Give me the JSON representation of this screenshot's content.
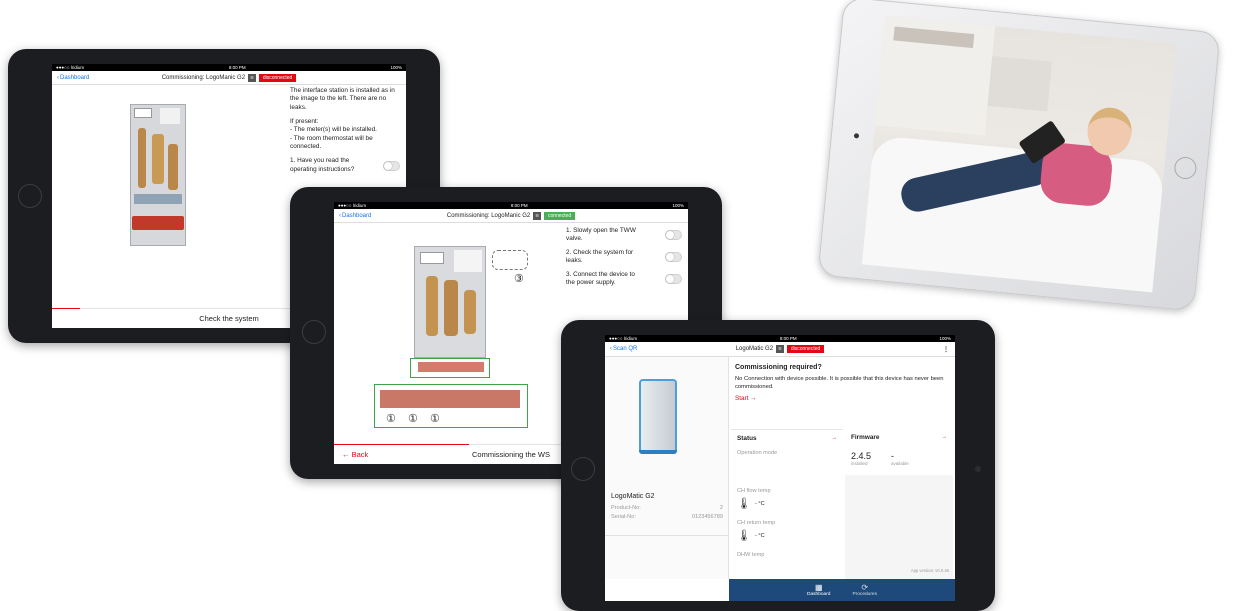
{
  "status": {
    "carrier": "●●●○○ lridium",
    "time": "8:00 PM",
    "battery": "100%"
  },
  "tablet1": {
    "back_label": "Dashboard",
    "title": "Commissioning: LogoManic G2",
    "conn_label": "disconnected",
    "instruction_1": "The interface station is installed as in the image to the left. There are no leaks.",
    "instruction_2_head": "If present:",
    "instruction_2_a": "- The meter(s) will be installed.",
    "instruction_2_b": "- The room thermostat will be connected.",
    "question": "1. Have you read the operating instructions?",
    "footer": "Check the system",
    "progress": 0.08
  },
  "tablet2": {
    "back_label": "Dashboard",
    "title": "Commissioning: LogoManic G2",
    "conn_label": "connected",
    "steps": [
      {
        "label": "1. Slowly open the TWW valve."
      },
      {
        "label": "2. Check the system for leaks."
      },
      {
        "label": "3. Connect the device to the power supply."
      }
    ],
    "callout_valve": "③",
    "callout_markers": [
      "①",
      "①",
      "①"
    ],
    "footer": "Commissioning the WS",
    "back_link": "← Back",
    "progress": 0.38
  },
  "tablet3": {
    "back_label": "Scan QR",
    "title": "LogoMatic G2",
    "conn_label": "disconnected",
    "menu": "⋮",
    "device_name": "LogoMatic G2",
    "product_no_label": "Product-No:",
    "product_no": "2",
    "serial_no_label": "Serial-No:",
    "serial_no": "0123456789",
    "alert_title": "Commissioning required?",
    "alert_text": "No Connection with device possible. It is possible that this device has never been commissioned.",
    "start_link": "Start →",
    "status_title": "Status",
    "firmware_title": "Firmware",
    "operation_mode": "Operation mode",
    "fw_installed_value": "2.4.5",
    "fw_installed_label": "installed",
    "fw_available_value": "-",
    "fw_available_label": "available",
    "ch_flow": "CH flow temp",
    "ch_flow_value": "- °C",
    "ch_return": "CH return temp",
    "ch_return_value": "- °C",
    "dhw": "DHW temp",
    "app_version": "App version: v0.0.45",
    "tab_dashboard": "Dashboard",
    "tab_procedures": "Procedures",
    "arrow": "→"
  },
  "colors": {
    "accent_red": "#e30613",
    "connected_green": "#4caf50",
    "tabbar_blue": "#1d4a7a",
    "ios_blue": "#1a73e8"
  }
}
